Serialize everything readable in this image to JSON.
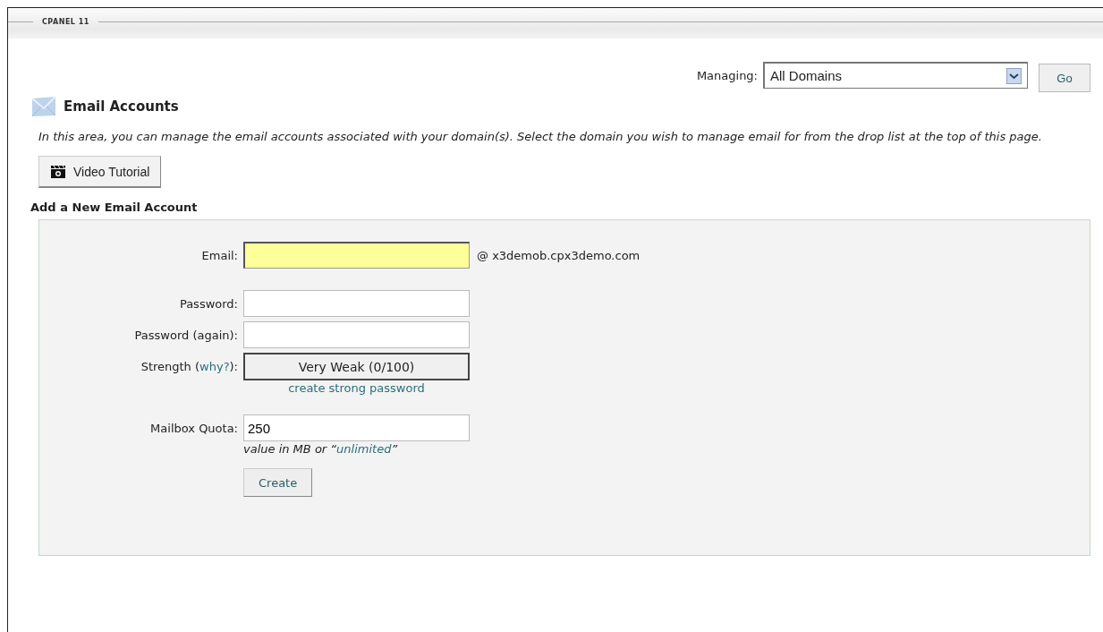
{
  "header": {
    "title": "CPANEL 11"
  },
  "managing": {
    "label": "Managing:",
    "value": "All Domains",
    "button": "Go"
  },
  "page": {
    "title": "Email Accounts",
    "description": "In this area, you can manage the email accounts associated with your domain(s). Select the domain you wish to manage email for from the drop list at the top of this page.",
    "video_button": "Video Tutorial"
  },
  "form": {
    "title": "Add a New Email Account",
    "email": {
      "label": "Email:",
      "highlighted": true,
      "domain": "@ x3demob.cpx3demo.com"
    },
    "password": {
      "label": "Password:"
    },
    "password_again": {
      "label": "Password (again):"
    },
    "strength": {
      "label_prefix": "Strength (",
      "label_link": "why?",
      "label_suffix": "):",
      "meter": "Very Weak (0/100)",
      "generate_link": "create strong password"
    },
    "quota": {
      "label": "Mailbox Quota:",
      "value": "250",
      "hint_prefix": "value in MB or “",
      "hint_link": "unlimited",
      "hint_suffix": "”"
    },
    "submit": "Create"
  }
}
